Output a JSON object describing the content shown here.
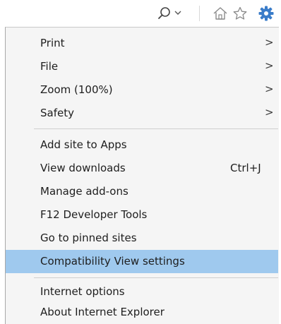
{
  "toolbar": {
    "search_icon": "search-icon",
    "search_dropdown_icon": "chevron-down-icon",
    "home_icon": "home-icon",
    "favorites_icon": "star-icon",
    "tools_icon": "gear-icon",
    "accent_color": "#3a7cc9"
  },
  "menu": {
    "highlight_color": "#9fc9ee",
    "background_color": "#f5f5f5",
    "items": [
      {
        "label": "Print",
        "submenu": true
      },
      {
        "label": "File",
        "submenu": true
      },
      {
        "label": "Zoom (100%)",
        "submenu": true
      },
      {
        "label": "Safety",
        "submenu": true
      },
      {
        "label": "Add site to Apps"
      },
      {
        "label": "View downloads",
        "shortcut": "Ctrl+J"
      },
      {
        "label": "Manage add-ons"
      },
      {
        "label": "F12 Developer Tools"
      },
      {
        "label": "Go to pinned sites"
      },
      {
        "label": "Compatibility View settings",
        "highlighted": true
      },
      {
        "label": "Internet options"
      },
      {
        "label": "About Internet Explorer"
      }
    ],
    "submenu_arrow": ">"
  }
}
